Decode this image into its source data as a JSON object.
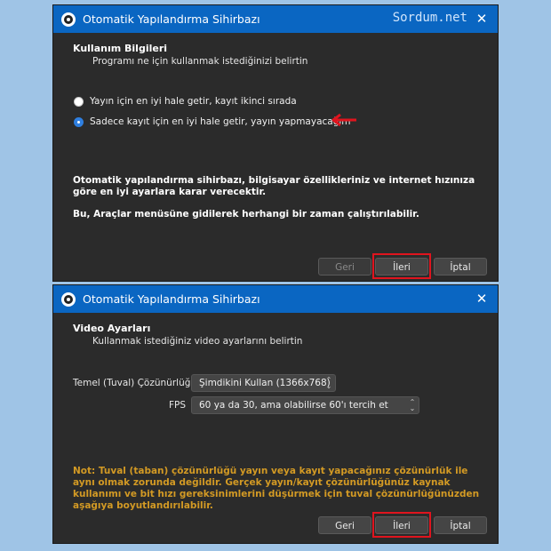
{
  "watermark": "Sordum.net",
  "window1": {
    "title": "Otomatik Yapılandırma Sihirbazı",
    "section_title": "Kullanım Bilgileri",
    "section_sub": "Programı ne için kullanmak istediğinizi belirtin",
    "radio_options": [
      {
        "label": "Yayın için en iyi hale getir, kayıt ikinci sırada",
        "checked": false
      },
      {
        "label": "Sadece kayıt için en iyi hale getir, yayın yapmayacağım",
        "checked": true
      }
    ],
    "info_text": "Otomatik yapılandırma sihirbazı, bilgisayar özellikleriniz ve internet hızınıza göre en iyi ayarlara karar verecektir.",
    "info_text2": "Bu, Araçlar menüsüne gidilerek herhangi bir zaman çalıştırılabilir.",
    "buttons": {
      "back": "Geri",
      "next": "İleri",
      "cancel": "İptal"
    }
  },
  "window2": {
    "title": "Otomatik Yapılandırma Sihirbazı",
    "section_title": "Video Ayarları",
    "section_sub": "Kullanmak istediğiniz video ayarlarını belirtin",
    "resolution_label": "Temel (Tuval) Çözünürlüğü",
    "resolution_value": "Şimdikini Kullan (1366x768)",
    "fps_label": "FPS",
    "fps_value": "60 ya da 30, ama olabilirse 60'ı tercih et",
    "note": "Not: Tuval (taban) çözünürlüğü yayın veya kayıt yapacağınız çözünürlük ile aynı olmak zorunda değildir. Gerçek yayın/kayıt çözünürlüğünüz kaynak kullanımı ve bit hızı gereksinimlerini düşürmek için tuval çözünürlüğünüzden aşağıya boyutlandırılabilir.",
    "buttons": {
      "back": "Geri",
      "next": "İleri",
      "cancel": "İptal"
    }
  },
  "colors": {
    "titlebar": "#0a66c2",
    "highlight": "#e0141e",
    "note": "#d39a24"
  },
  "icons": {
    "app": "obs-logo-icon",
    "close": "close-icon",
    "arrow": "red-arrow-icon"
  }
}
